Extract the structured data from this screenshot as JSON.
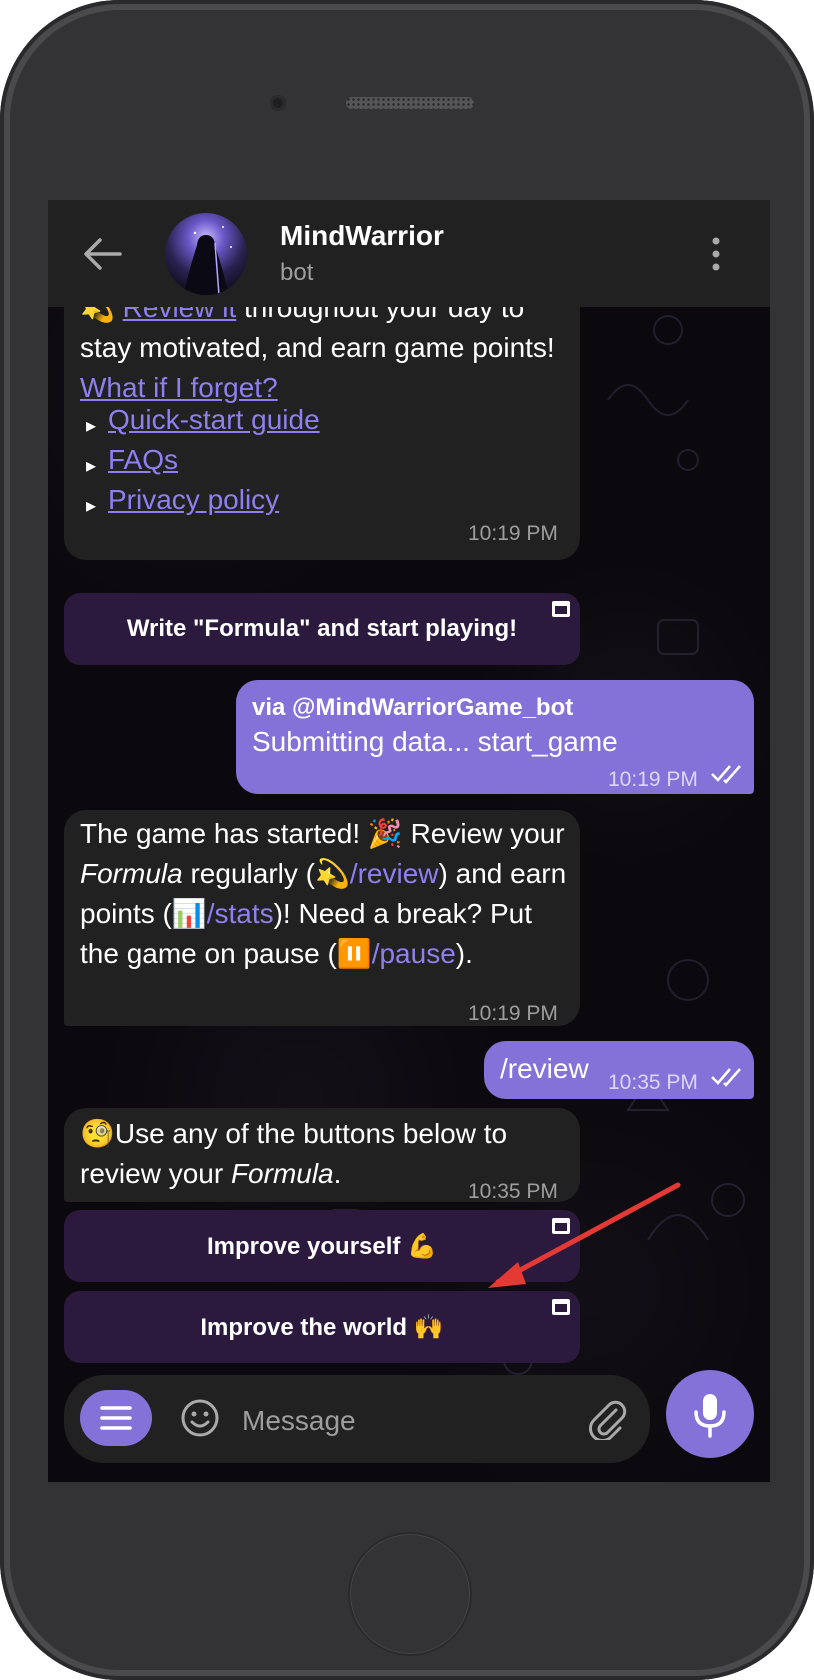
{
  "header": {
    "title": "MindWarrior",
    "subtitle": "bot"
  },
  "messages": {
    "first": {
      "prefix": "💫 ",
      "link1": "Review it",
      "text1": " throughout your day to stay motivated, and earn game points! ",
      "link2": "What if I forget?",
      "bullet": "▸",
      "item1": "Quick-start guide",
      "item2": "FAQs",
      "item3": "Privacy policy",
      "time": "10:19 PM",
      "button": "Write \"Formula\" and start playing!"
    },
    "outgoing1": {
      "via": "via @MindWarriorGame_bot",
      "text": "Submitting data... start_game",
      "time": "10:19 PM"
    },
    "second": {
      "t1": "The game has started! 🎉 Review your ",
      "formula": "Formula",
      "t2": " regularly (💫",
      "cmd1": "/review",
      "t3": ") and earn points (📊",
      "cmd2": "/stats",
      "t4": ")! Need a break? Put the game on pause (⏸️",
      "cmd3": "/pause",
      "t5": ").",
      "time": "10:19 PM"
    },
    "outgoing2": {
      "text": "/review",
      "time": "10:35 PM"
    },
    "third": {
      "t1": "🧐Use any of the buttons below to review your ",
      "formula": "Formula",
      "t2": ".",
      "time": "10:35 PM",
      "button1": "Improve yourself 💪",
      "button2": "Improve the world 🙌"
    }
  },
  "composer": {
    "placeholder": "Message"
  },
  "colors": {
    "accent": "#8572d9",
    "bubble_in": "#212121",
    "inline_button": "#2b1a3d",
    "annotation_arrow": "#e53935"
  }
}
